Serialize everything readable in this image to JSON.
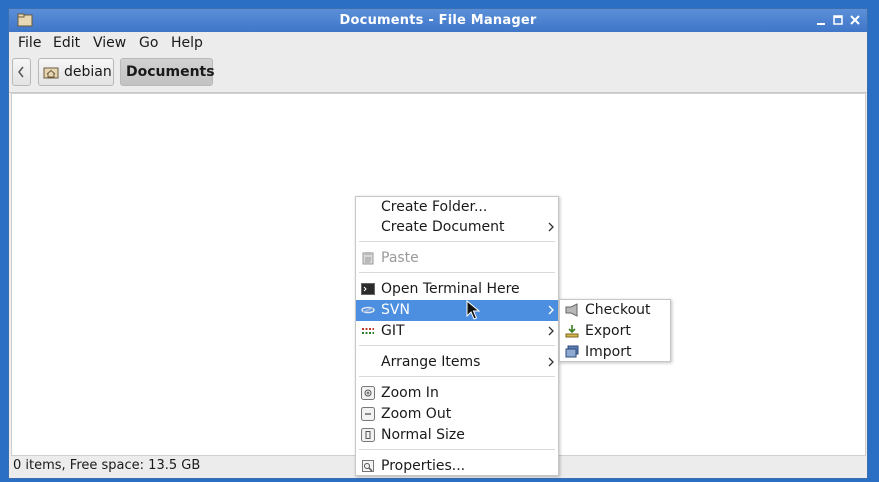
{
  "window": {
    "title": "Documents - File Manager"
  },
  "menubar": {
    "items": [
      "File",
      "Edit",
      "View",
      "Go",
      "Help"
    ]
  },
  "path": {
    "crumbs": [
      {
        "label": "debian",
        "icon": "home-folder-icon"
      },
      {
        "label": "Documents",
        "active": true
      }
    ]
  },
  "status": {
    "text": "0 items, Free space: 13.5 GB"
  },
  "context_menu": {
    "items": [
      {
        "label": "Create Folder...",
        "icon": ""
      },
      {
        "label": "Create Document",
        "submenu": true
      },
      {
        "label": "Paste",
        "icon": "paste-icon",
        "disabled": true
      },
      {
        "label": "Open Terminal Here",
        "icon": "terminal-icon"
      },
      {
        "label": "SVN",
        "icon": "svn-icon",
        "submenu": true,
        "highlighted": true
      },
      {
        "label": "GIT",
        "icon": "git-icon",
        "submenu": true
      },
      {
        "label": "Arrange Items",
        "submenu": true
      },
      {
        "label": "Zoom In",
        "icon": "zoom-in-icon"
      },
      {
        "label": "Zoom Out",
        "icon": "zoom-out-icon"
      },
      {
        "label": "Normal Size",
        "icon": "zoom-normal-icon"
      },
      {
        "label": "Properties...",
        "icon": "properties-icon"
      }
    ]
  },
  "svn_submenu": {
    "items": [
      {
        "label": "Checkout",
        "icon": "checkout-icon"
      },
      {
        "label": "Export",
        "icon": "export-icon"
      },
      {
        "label": "Import",
        "icon": "import-icon"
      }
    ]
  },
  "colors": {
    "titlebar": "#3f76c8",
    "highlight": "#4c8fe0",
    "desktop": "#2a6fc4"
  }
}
